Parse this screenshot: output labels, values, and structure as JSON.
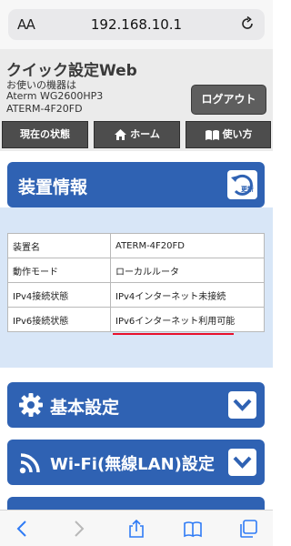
{
  "browser": {
    "text_size_label": "AA",
    "url": "192.168.10.1"
  },
  "header": {
    "title": "クイック設定Web",
    "device_label": "お使いの機器は",
    "device_model": "Aterm WG2600HP3",
    "device_name": "ATERM-4F20FD",
    "logout_label": "ログアウト"
  },
  "nav": {
    "status_label": "現在の状態",
    "home_label": "ホーム",
    "help_label": "使い方"
  },
  "device_info": {
    "title": "装置情報",
    "refresh_label": "更新",
    "rows": [
      {
        "key": "装置名",
        "value": "ATERM-4F20FD"
      },
      {
        "key": "動作モード",
        "value": "ローカルルータ"
      },
      {
        "key": "IPv4接続状態",
        "value": "IPv4インターネット未接続"
      },
      {
        "key": "IPv6接続状態",
        "value": "IPv6インターネット利用可能"
      }
    ]
  },
  "sections": {
    "basic_label": "基本設定",
    "wifi_label": "Wi-Fi(無線LAN)設定"
  },
  "colors": {
    "accent": "#2f62b3",
    "panel_bg": "#d8e6f7",
    "highlight": "#e8102c"
  }
}
